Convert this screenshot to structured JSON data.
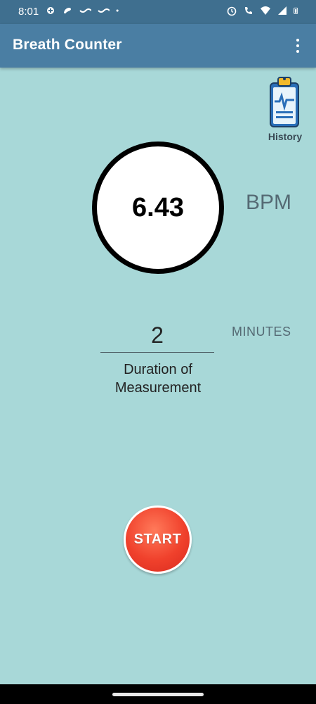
{
  "status_bar": {
    "time": "8:01",
    "left_icons": [
      "notification-icon",
      "app-icon",
      "wave-icon",
      "wave-icon",
      "dot-icon"
    ],
    "right_icons": [
      "alarm-icon",
      "wifi-calling-icon",
      "wifi-icon",
      "signal-icon",
      "battery-icon"
    ]
  },
  "app_bar": {
    "title": "Breath Counter",
    "menu_icon": "more-vertical-icon"
  },
  "history": {
    "label": "History",
    "icon": "clipboard-pulse-icon"
  },
  "measurement": {
    "value": "6.43",
    "unit": "BPM"
  },
  "duration": {
    "value": "2",
    "unit": "MINUTES",
    "label": "Duration of Measurement"
  },
  "start_button": {
    "label": "START"
  },
  "colors": {
    "background": "#a8d8d8",
    "app_bar": "#4a7ea3",
    "status_bar": "#3f6f8f",
    "start_red": "#f0412c"
  }
}
